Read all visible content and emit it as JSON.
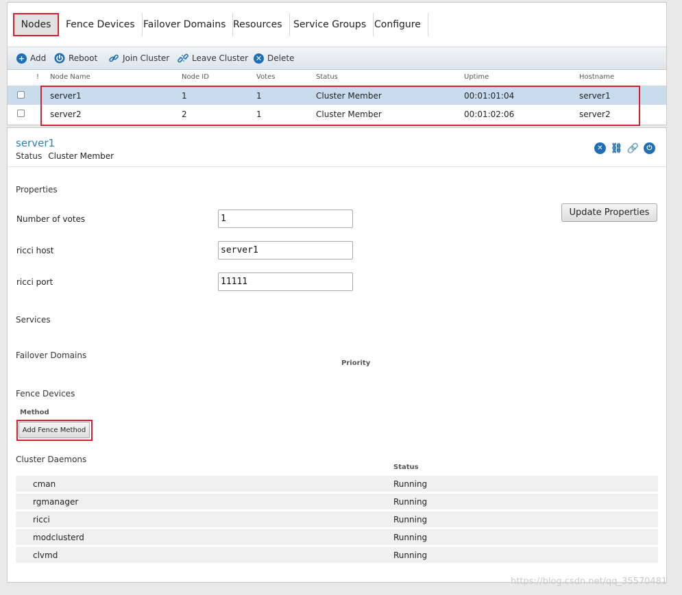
{
  "tabs": [
    "Nodes",
    "Fence Devices",
    "Failover Domains",
    "Resources",
    "Service Groups",
    "Configure"
  ],
  "toolbar": {
    "add": "Add",
    "reboot": "Reboot",
    "join": "Join Cluster",
    "leave": "Leave Cluster",
    "delete": "Delete"
  },
  "table": {
    "headers": [
      "!",
      "Node Name",
      "Node ID",
      "Votes",
      "Status",
      "Uptime",
      "Hostname"
    ],
    "rows": [
      {
        "name": "server1",
        "id": "1",
        "votes": "1",
        "status": "Cluster Member",
        "uptime": "00:01:01:04",
        "hostname": "server1"
      },
      {
        "name": "server2",
        "id": "2",
        "votes": "1",
        "status": "Cluster Member",
        "uptime": "00:01:02:06",
        "hostname": "server2"
      }
    ]
  },
  "detail": {
    "title": "server1",
    "status_label": "Status",
    "status_value": "Cluster Member",
    "properties_heading": "Properties",
    "update_button": "Update Properties",
    "fields": [
      {
        "label": "Number of votes",
        "value": "1"
      },
      {
        "label": "ricci host",
        "value": "server1"
      },
      {
        "label": "ricci port",
        "value": "11111"
      }
    ],
    "services_heading": "Services",
    "failover_heading": "Failover Domains",
    "priority_header": "Priority",
    "fence_heading": "Fence Devices",
    "method_header": "Method",
    "add_fence_button": "Add Fence Method",
    "daemons_heading": "Cluster Daemons",
    "daemon_status_header": "Status",
    "daemons": [
      {
        "name": "cman",
        "status": "Running"
      },
      {
        "name": "rgmanager",
        "status": "Running"
      },
      {
        "name": "ricci",
        "status": "Running"
      },
      {
        "name": "modclusterd",
        "status": "Running"
      },
      {
        "name": "clvmd",
        "status": "Running"
      }
    ]
  },
  "watermark": "https://blog.csdn.net/qq_35570481",
  "colors": {
    "accent": "#1f6fb4",
    "highlight": "#d21f2b",
    "selected_row": "#c9dced"
  }
}
